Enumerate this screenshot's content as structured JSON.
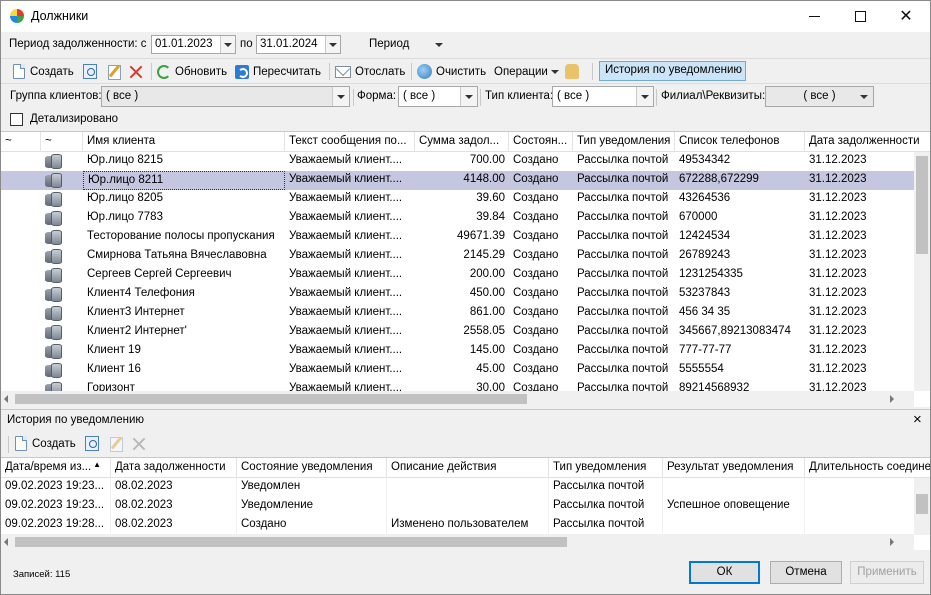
{
  "window": {
    "title": "Должники",
    "min_icon": "minimize-icon",
    "max_icon": "maximize-icon",
    "close_icon": "close-icon"
  },
  "period": {
    "label": "Период задолженности: с",
    "from": "01.01.2023",
    "to_label": "по",
    "to": "31.01.2024",
    "mode_label": "Период"
  },
  "toolbar": {
    "create": "Создать",
    "refresh": "Обновить",
    "recalc": "Пересчитать",
    "send": "Отослать",
    "clean": "Очистить",
    "operations": "Операции",
    "history": "История по уведомлению"
  },
  "filters": {
    "group_label": "Группа клиентов:",
    "group_value": "( все )",
    "form_label": "Форма:",
    "form_value": "( все )",
    "type_label": "Тип клиента:",
    "type_value": "( все )",
    "branch_label": "Филиал\\Реквизиты:",
    "branch_value": "( все )"
  },
  "detail": {
    "label": "Детализировано",
    "checked": false
  },
  "grid": {
    "columns": [
      "~",
      "~",
      "Имя клиента",
      "Текст сообщения по...",
      "Сумма задол...",
      "Состоян...",
      "Тип уведомления",
      "Список телефонов",
      "Дата задолженности"
    ],
    "rows": [
      {
        "name": "Юр.лицо 8215",
        "text": "Уважаемый клиент....",
        "sum": "700.00",
        "state": "Создано",
        "type": "Рассылка почтой",
        "phones": "49534342",
        "date": "31.12.2023"
      },
      {
        "name": "Юр.лицо 8211",
        "text": "Уважаемый клиент....",
        "sum": "4148.00",
        "state": "Создано",
        "type": "Рассылка почтой",
        "phones": "672288,672299",
        "date": "31.12.2023",
        "selected": true
      },
      {
        "name": "Юр.лицо 8205",
        "text": "Уважаемый клиент....",
        "sum": "39.60",
        "state": "Создано",
        "type": "Рассылка почтой",
        "phones": "43264536",
        "date": "31.12.2023"
      },
      {
        "name": "Юр.лицо 7783",
        "text": "Уважаемый клиент....",
        "sum": "39.84",
        "state": "Создано",
        "type": "Рассылка почтой",
        "phones": "670000",
        "date": "31.12.2023"
      },
      {
        "name": "Тесторование полосы пропускания",
        "text": "Уважаемый клиент....",
        "sum": "49671.39",
        "state": "Создано",
        "type": "Рассылка почтой",
        "phones": "12424534",
        "date": "31.12.2023"
      },
      {
        "name": "Смирнова Татьяна Вячеславовна",
        "text": "Уважаемый клиент....",
        "sum": "2145.29",
        "state": "Создано",
        "type": "Рассылка почтой",
        "phones": "26789243",
        "date": "31.12.2023"
      },
      {
        "name": "Сергеев Сергей Сергеевич",
        "text": "Уважаемый клиент....",
        "sum": "200.00",
        "state": "Создано",
        "type": "Рассылка почтой",
        "phones": "1231254335",
        "date": "31.12.2023"
      },
      {
        "name": "Клиент4 Телефония",
        "text": "Уважаемый клиент....",
        "sum": "450.00",
        "state": "Создано",
        "type": "Рассылка почтой",
        "phones": "53237843",
        "date": "31.12.2023"
      },
      {
        "name": "Клиент3 Интернет",
        "text": "Уважаемый клиент....",
        "sum": "861.00",
        "state": "Создано",
        "type": "Рассылка почтой",
        "phones": "456 34 35",
        "date": "31.12.2023"
      },
      {
        "name": "Клиент2 Интернет'",
        "text": "Уважаемый клиент....",
        "sum": "2558.05",
        "state": "Создано",
        "type": "Рассылка почтой",
        "phones": "345667,89213083474",
        "date": "31.12.2023"
      },
      {
        "name": "Клиент 19",
        "text": "Уважаемый клиент....",
        "sum": "145.00",
        "state": "Создано",
        "type": "Рассылка почтой",
        "phones": "777-77-77",
        "date": "31.12.2023"
      },
      {
        "name": "Клиент 16",
        "text": "Уважаемый клиент....",
        "sum": "45.00",
        "state": "Создано",
        "type": "Рассылка почтой",
        "phones": "5555554",
        "date": "31.12.2023"
      },
      {
        "name": "Горизонт",
        "text": "Уважаемый клиент....",
        "sum": "30.00",
        "state": "Создано",
        "type": "Рассылка почтой",
        "phones": "89214568932",
        "date": "31.12.2023"
      }
    ]
  },
  "history_panel": {
    "title": "История по уведомлению",
    "close": "×",
    "create": "Создать",
    "columns": [
      "Дата/время из...",
      "Дата задолженности",
      "Состояние уведомления",
      "Описание действия",
      "Тип уведомления",
      "Результат уведомления",
      "Длительность соедине"
    ],
    "rows": [
      {
        "dt": "09.02.2023 19:23...",
        "date": "08.02.2023",
        "state": "Уведомлен",
        "desc": "",
        "type": "Рассылка почтой",
        "result": ""
      },
      {
        "dt": "09.02.2023 19:23...",
        "date": "08.02.2023",
        "state": "Уведомление",
        "desc": "",
        "type": "Рассылка почтой",
        "result": "Успешное оповещение"
      },
      {
        "dt": "09.02.2023 19:28...",
        "date": "08.02.2023",
        "state": "Создано",
        "desc": "Изменено пользователем",
        "type": "Рассылка почтой",
        "result": ""
      }
    ]
  },
  "footer": {
    "records": "Записей: 115",
    "ok": "ОК",
    "cancel": "Отмена",
    "apply": "Применить"
  }
}
